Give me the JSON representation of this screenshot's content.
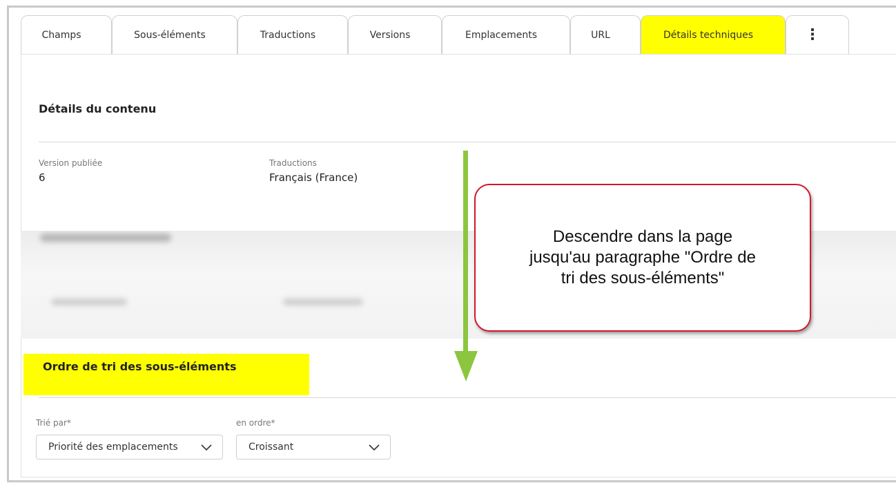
{
  "tabs": [
    {
      "label": "Champs"
    },
    {
      "label": "Sous-éléments"
    },
    {
      "label": "Traductions"
    },
    {
      "label": "Versions"
    },
    {
      "label": "Emplacements"
    },
    {
      "label": "URL"
    },
    {
      "label": "Détails techniques",
      "active": true
    },
    {
      "label": "⋮",
      "icon": "more-vertical-icon"
    }
  ],
  "content_details": {
    "title": "Détails du contenu",
    "published_version": {
      "label": "Version publiée",
      "value": "6"
    },
    "translations": {
      "label": "Traductions",
      "value": "Français (France)"
    }
  },
  "sort_order": {
    "title": "Ordre de tri des sous-éléments",
    "sorted_by": {
      "label": "Trié par*",
      "value": "Priorité des emplacements"
    },
    "order": {
      "label": "en ordre*",
      "value": "Croissant"
    }
  },
  "annotation": {
    "text": "Descendre dans la page jusqu'au paragraphe \"Ordre de tri des sous-éléments\"",
    "highlight_color": "#ffff00",
    "border_color": "#d0192a",
    "arrow_color": "#8cc63f"
  }
}
